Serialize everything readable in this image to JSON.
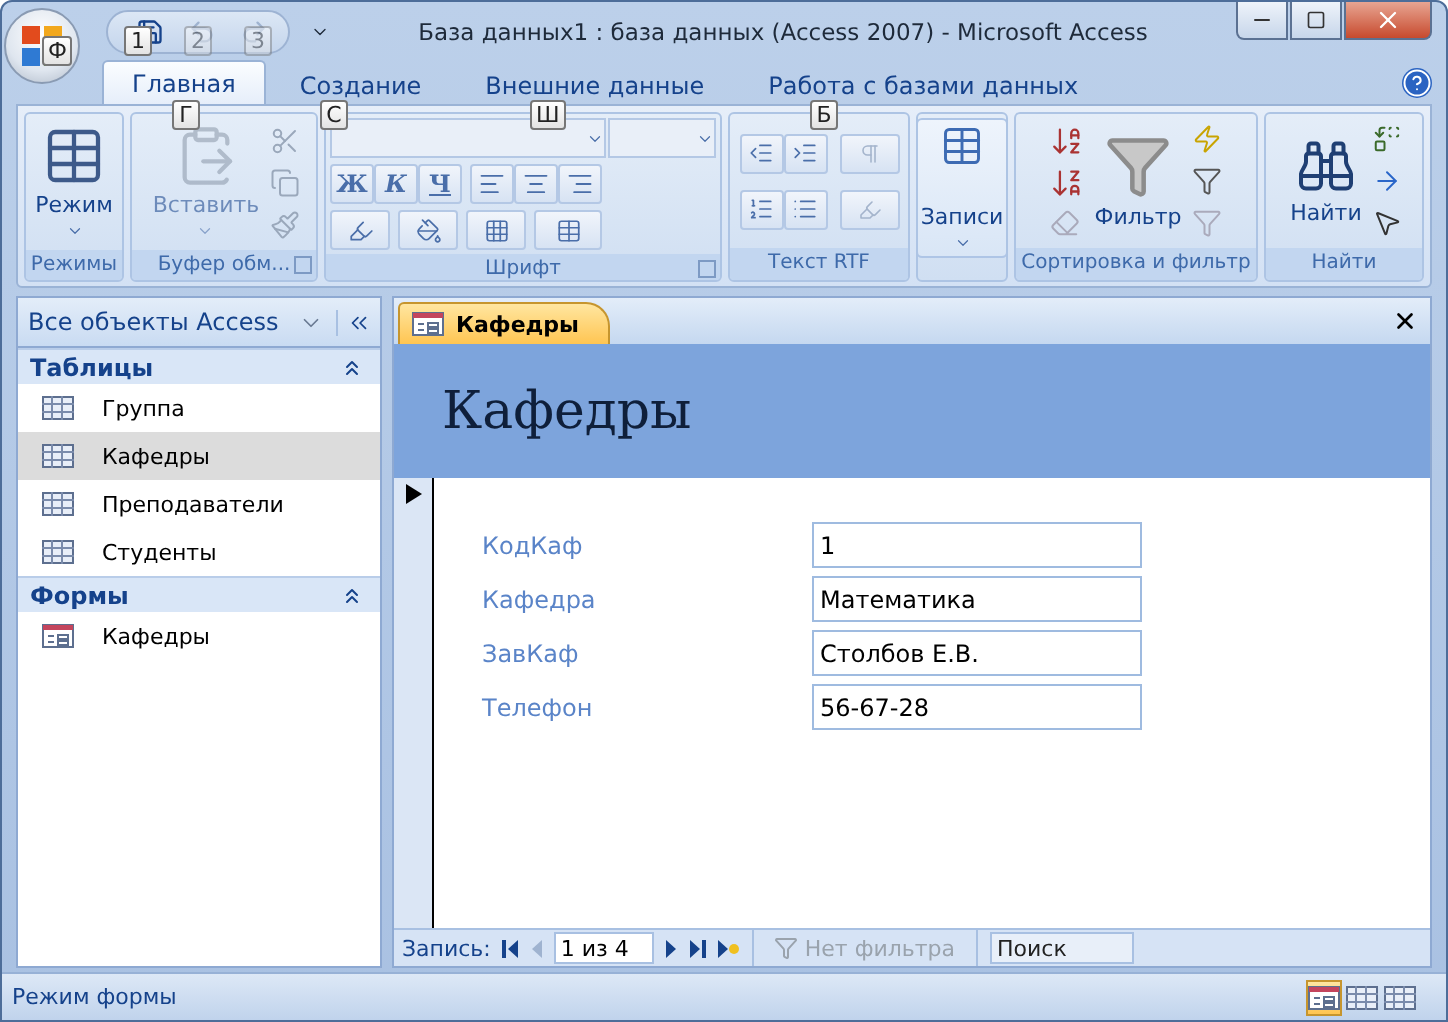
{
  "window": {
    "title": "База данных1 : база данных (Access 2007) - Microsoft Access"
  },
  "office_button": {
    "key_tip": "Ф"
  },
  "quick_access": [
    {
      "kind": "save",
      "key_tip": "1",
      "disabled": false
    },
    {
      "kind": "undo",
      "key_tip": "2",
      "disabled": true
    },
    {
      "kind": "redo",
      "key_tip": "3",
      "disabled": true
    }
  ],
  "ribbon_tabs": [
    {
      "label": "Главная",
      "selected": true,
      "key_tip": "Г"
    },
    {
      "label": "Создание",
      "selected": false,
      "key_tip": "С"
    },
    {
      "label": "Внешние данные",
      "selected": false,
      "key_tip": "Ш"
    },
    {
      "label": "Работа с базами данных",
      "selected": false,
      "key_tip": "Б"
    }
  ],
  "ribbon_groups": [
    {
      "kind": "views",
      "title": "Режимы",
      "button": "Режим"
    },
    {
      "kind": "clipboard",
      "title": "Буфер обм...",
      "button": "Вставить"
    },
    {
      "kind": "font",
      "title": "Шрифт",
      "format_buttons": [
        "Ж",
        "К",
        "Ч"
      ]
    },
    {
      "kind": "rtf",
      "title": "Текст RTF"
    },
    {
      "kind": "records",
      "button": "Записи"
    },
    {
      "kind": "sort",
      "title": "Сортировка и фильтр",
      "button": "Фильтр"
    },
    {
      "kind": "find",
      "title": "Найти",
      "button": "Найти"
    }
  ],
  "nav_pane": {
    "title": "Все объекты Access",
    "sections": [
      {
        "title": "Таблицы",
        "expanded": true,
        "items": [
          {
            "label": "Группа",
            "kind": "table",
            "selected": false
          },
          {
            "label": "Кафедры",
            "kind": "table",
            "selected": true
          },
          {
            "label": "Преподаватели",
            "kind": "table",
            "selected": false
          },
          {
            "label": "Студенты",
            "kind": "table",
            "selected": false
          }
        ]
      },
      {
        "title": "Формы",
        "expanded": true,
        "items": [
          {
            "label": "Кафедры",
            "kind": "form",
            "selected": false
          }
        ]
      }
    ]
  },
  "document": {
    "tab": "Кафедры",
    "form_title": "Кафедры",
    "fields": [
      {
        "label": "КодКаф",
        "value": "1"
      },
      {
        "label": "Кафедра",
        "value": "Математика"
      },
      {
        "label": "ЗавКаф",
        "value": "Столбов Е.В."
      },
      {
        "label": "Телефон",
        "value": "56-67-28"
      }
    ],
    "record_nav": {
      "label": "Запись:",
      "position": "1 из 4",
      "filter": "Нет фильтра",
      "search_placeholder": "Поиск"
    }
  },
  "status_bar": {
    "text": "Режим формы",
    "views": [
      {
        "kind": "form",
        "selected": true
      },
      {
        "kind": "layout",
        "selected": false
      },
      {
        "kind": "design",
        "selected": false
      }
    ]
  }
}
